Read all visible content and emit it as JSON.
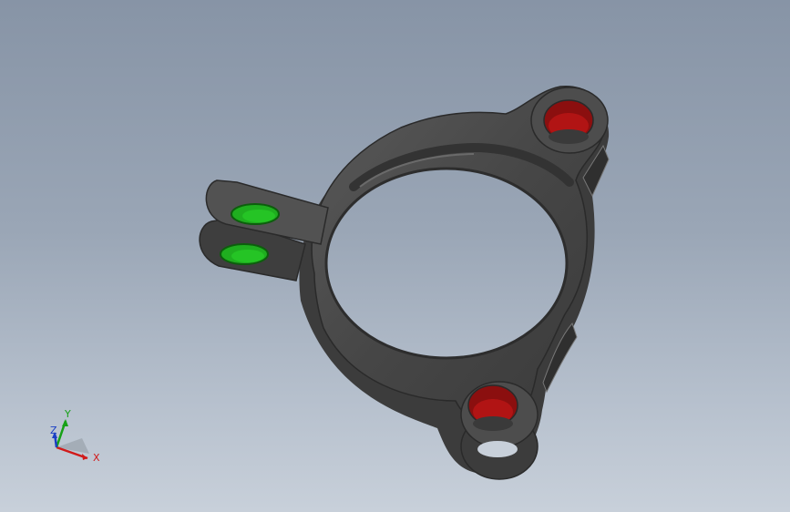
{
  "viewport": {
    "model": "clamp-part",
    "background_top": "#8794a6",
    "background_bottom": "#c8d0da",
    "part_color": "#4a4a4a",
    "green_face_color": "#1fae1f",
    "red_face_color": "#b11414"
  },
  "triad": {
    "x_label": "X",
    "y_label": "Y",
    "z_label": "Z",
    "x_color": "#d11a1a",
    "y_color": "#17a117",
    "z_color": "#1b3fc4"
  }
}
